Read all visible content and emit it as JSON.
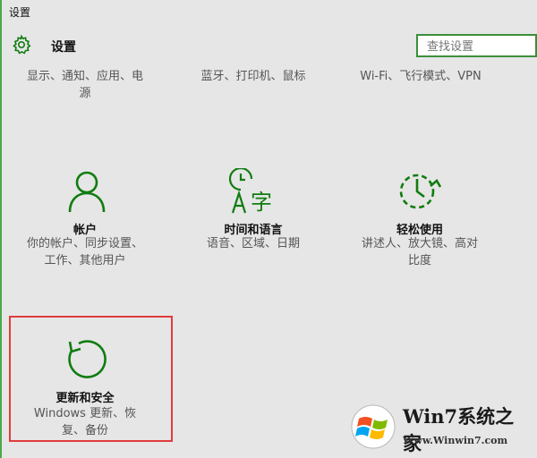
{
  "window": {
    "title": "设置"
  },
  "header": {
    "title": "设置",
    "search_placeholder": "查找设置"
  },
  "top_row": [
    {
      "desc_line1": "显示、通知、应用、电",
      "desc_line2": "源"
    },
    {
      "desc_line1": "蓝牙、打印机、鼠标"
    },
    {
      "desc_line1": "Wi-Fi、飞行模式、VPN"
    }
  ],
  "tiles": [
    {
      "label": "帐户",
      "desc_line1": "你的帐户、同步设置、",
      "desc_line2": "工作、其他用户",
      "icon": "person-icon"
    },
    {
      "label": "时间和语言",
      "desc_line1": "语音、区域、日期",
      "icon": "time-language-icon"
    },
    {
      "label": "轻松使用",
      "desc_line1": "讲述人、放大镜、高对",
      "desc_line2": "比度",
      "icon": "ease-of-access-icon"
    },
    {
      "label": "更新和安全",
      "desc_line1": "Windows 更新、恢",
      "desc_line2": "复、备份",
      "icon": "update-refresh-icon"
    }
  ],
  "watermark": {
    "brand": "Win7系统之家",
    "url": "Www.Winwin7.com"
  },
  "colors": {
    "accent": "#107c10",
    "highlight": "#e03c3c",
    "background": "#e6e6e6"
  }
}
